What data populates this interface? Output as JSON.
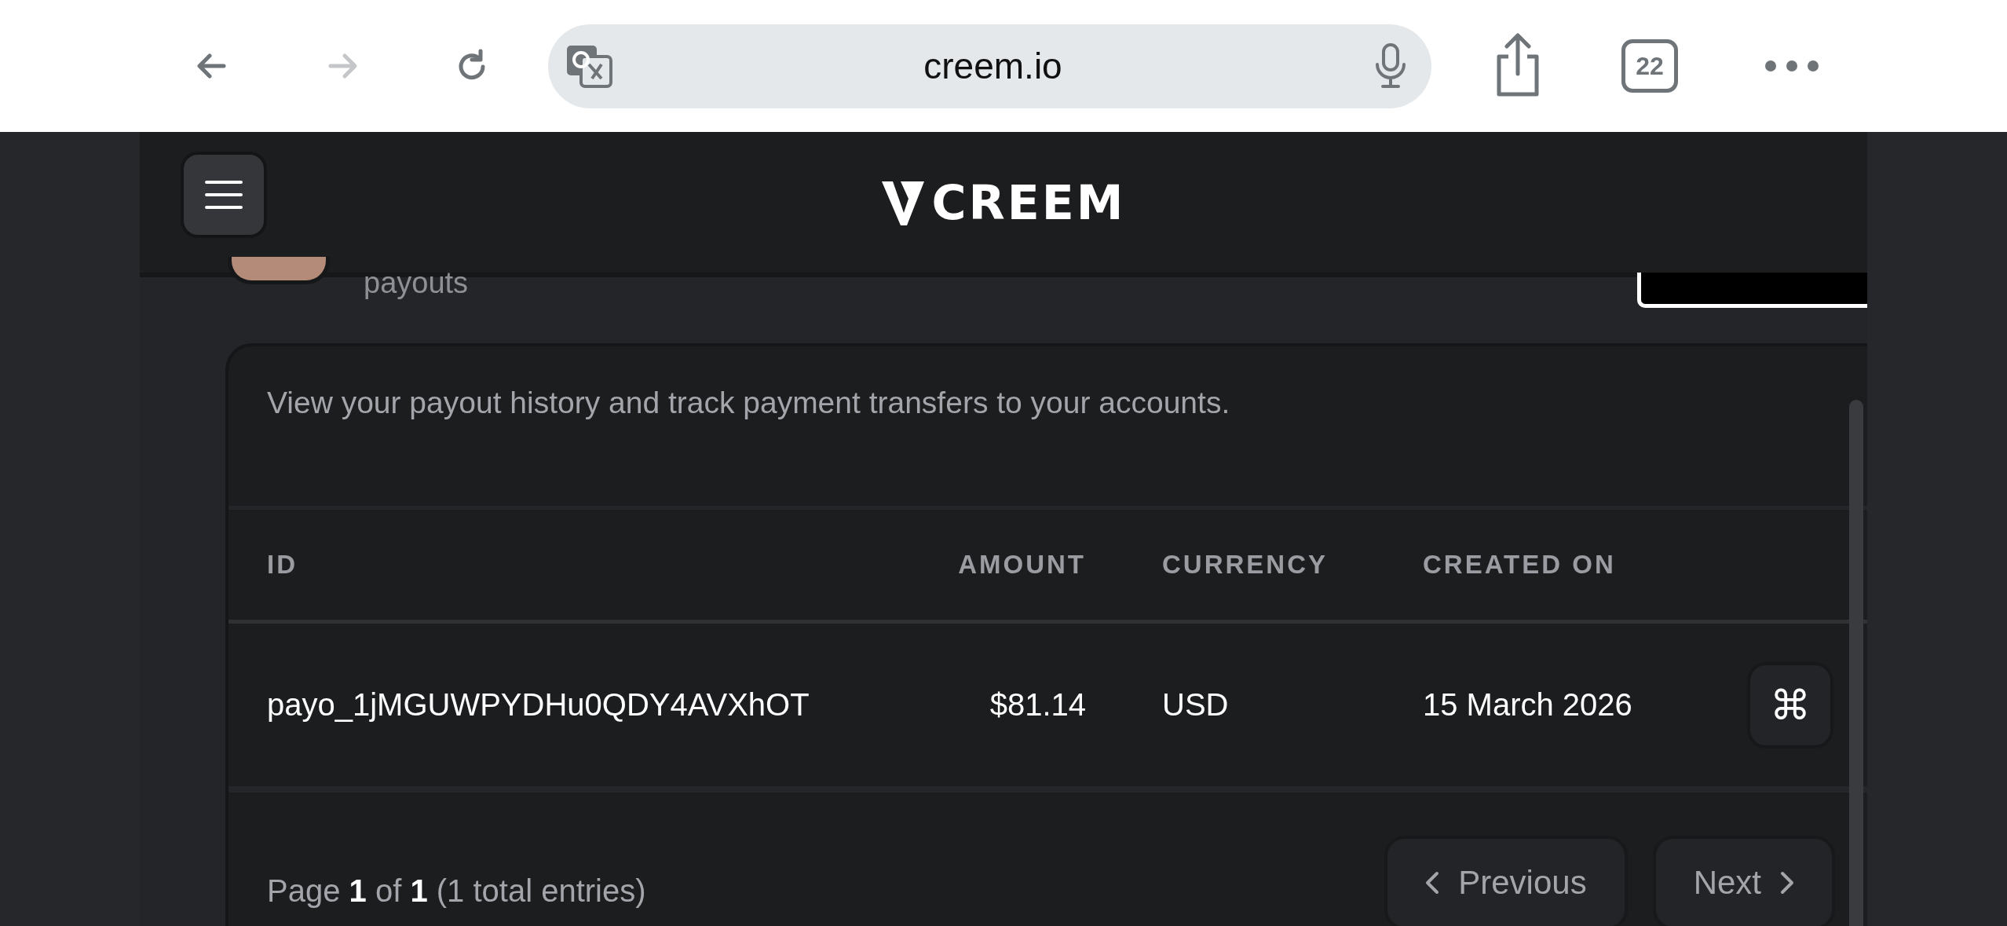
{
  "browser": {
    "nav": [
      {
        "kind": "back",
        "disabled": false
      },
      {
        "kind": "forward",
        "disabled": true
      },
      {
        "kind": "reload",
        "disabled": false
      }
    ],
    "url": "creem.io",
    "tab_count": "22"
  },
  "header": {
    "logo": "CREEM"
  },
  "page": {
    "subtitle": "payouts"
  },
  "card": {
    "description": "View your payout history and track payment transfers to your accounts.",
    "columns": [
      "ID",
      "AMOUNT",
      "CURRENCY",
      "CREATED ON"
    ],
    "rows": [
      {
        "id": "payo_1jMGUWPYDHu0QDY4AVXhOT",
        "amount": "$81.14",
        "currency": "USD",
        "created_on": "15 March 2026",
        "action": "⌘"
      }
    ],
    "pagination": {
      "summary": "Page **1** of **1** (1 total entries)",
      "previous": "Previous",
      "next": "Next"
    }
  }
}
